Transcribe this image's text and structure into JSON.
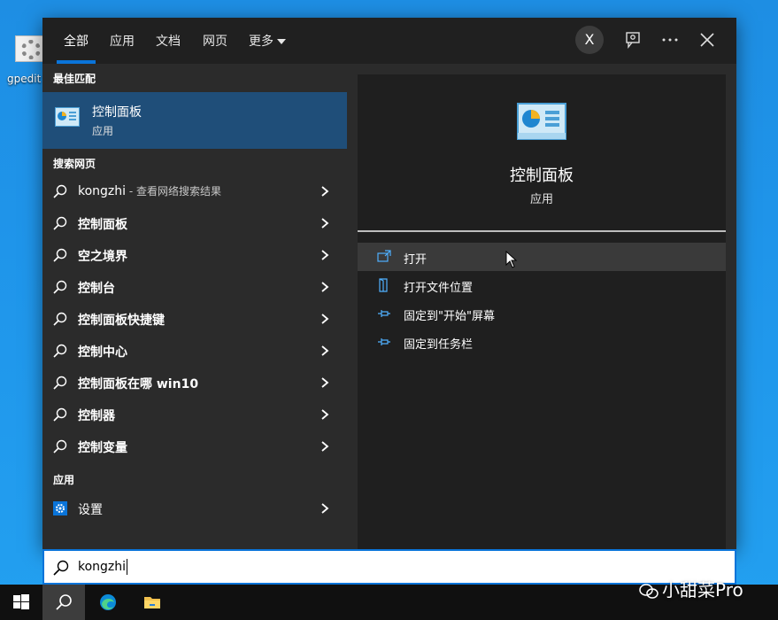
{
  "desktop": {
    "icon_label": "gpedit"
  },
  "tabs": [
    "全部",
    "应用",
    "文档",
    "网页",
    "更多"
  ],
  "header": {
    "avatar_letter": "X"
  },
  "sections": {
    "best_match": "最佳匹配",
    "web": "搜索网页",
    "apps": "应用"
  },
  "best_match": {
    "title": "控制面板",
    "subtitle": "应用"
  },
  "web_results": [
    {
      "text": "kongzhi",
      "suffix": " - 查看网络搜索结果"
    },
    {
      "text": "控制面板"
    },
    {
      "text": "空之境界"
    },
    {
      "text": "控制台"
    },
    {
      "text": "控制面板快捷键"
    },
    {
      "text": "控制中心"
    },
    {
      "text": "控制面板在哪 win10"
    },
    {
      "text": "控制器"
    },
    {
      "text": "控制变量"
    }
  ],
  "app_results": [
    {
      "text": "设置"
    }
  ],
  "preview": {
    "title": "控制面板",
    "subtitle": "应用",
    "actions": [
      "打开",
      "打开文件位置",
      "固定到\"开始\"屏幕",
      "固定到任务栏"
    ]
  },
  "search": {
    "value": "kongzhi"
  },
  "watermark": "小甜菜Pro",
  "colors": {
    "accent": "#0a74d9",
    "selected": "#1f4e79",
    "panel": "#2b2b2b",
    "desktop": "#1f95ea"
  },
  "icons": [
    "search-icon",
    "feedback-icon",
    "more-icon",
    "close-icon",
    "control-panel-icon",
    "settings-icon",
    "open-icon",
    "folder-location-icon",
    "pin-icon",
    "windows-start-icon",
    "edge-icon",
    "file-explorer-icon"
  ]
}
